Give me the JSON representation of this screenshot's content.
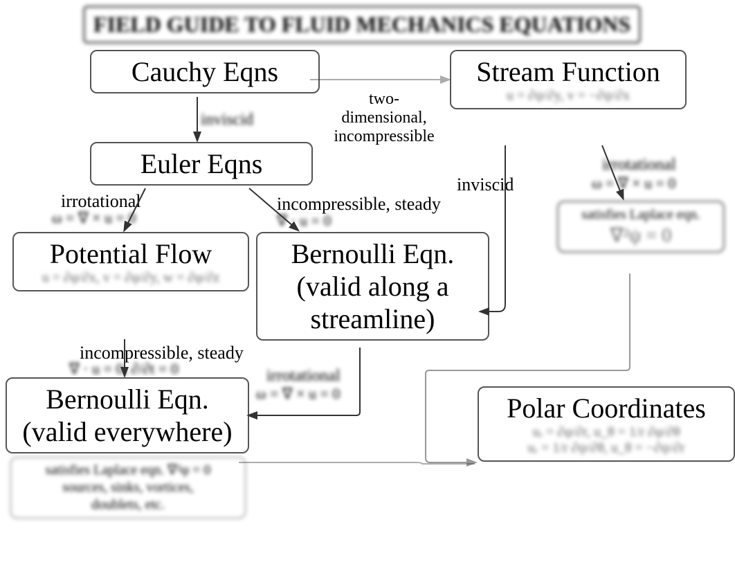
{
  "title": "FIELD GUIDE TO FLUID MECHANICS EQUATIONS",
  "boxes": {
    "cauchy": {
      "heading": "Cauchy Eqns"
    },
    "euler": {
      "heading": "Euler Eqns"
    },
    "stream": {
      "heading": "Stream Function",
      "eqn": "u = ∂ψ/∂y,   v = −∂ψ/∂x"
    },
    "potential": {
      "heading": "Potential Flow",
      "eqn": "u = ∂φ/∂x,  v = ∂φ/∂y,  w = ∂φ/∂z"
    },
    "bernoulli_streamline": {
      "line1": "Bernoulli Eqn.",
      "line2": "(valid along a",
      "line3": "streamline)"
    },
    "laplace": {
      "heading": "satisfies Laplace eqn.",
      "eqn": "∇²ψ = 0"
    },
    "bernoulli_everywhere": {
      "line1": "Bernoulli Eqn.",
      "line2": "(valid everywhere)"
    },
    "bernoulli_everywhere_sub": {
      "line1": "satisfies Laplace eqn. ∇²φ = 0",
      "line2": "sources, sinks, vortices,",
      "line3": "doublets, etc."
    },
    "polar": {
      "heading": "Polar Coordinates",
      "eqn1": "uᵣ = ∂φ/∂r,   u_θ = 1/r ∂φ/∂θ",
      "eqn2": "uᵣ = 1/r ∂ψ/∂θ,   u_θ = −∂ψ/∂r"
    }
  },
  "labels": {
    "inviscid_top": "inviscid",
    "two_d": "two-dimensional,\nincompressible",
    "inviscid_right": "inviscid",
    "irrotational_top": "irrotational",
    "incompressible_steady_mid": "incompressible, steady",
    "irrotational_right": "irrotational",
    "incompressible_steady_left": "incompressible, steady",
    "irrotational_mid": "irrotational"
  },
  "math": {
    "omega_zero": "ω = ∇ × u = 0",
    "div_zero": "∇ · u = 0",
    "div_and_dt": "∇ · u = 0,   ∂/∂t = 0"
  }
}
